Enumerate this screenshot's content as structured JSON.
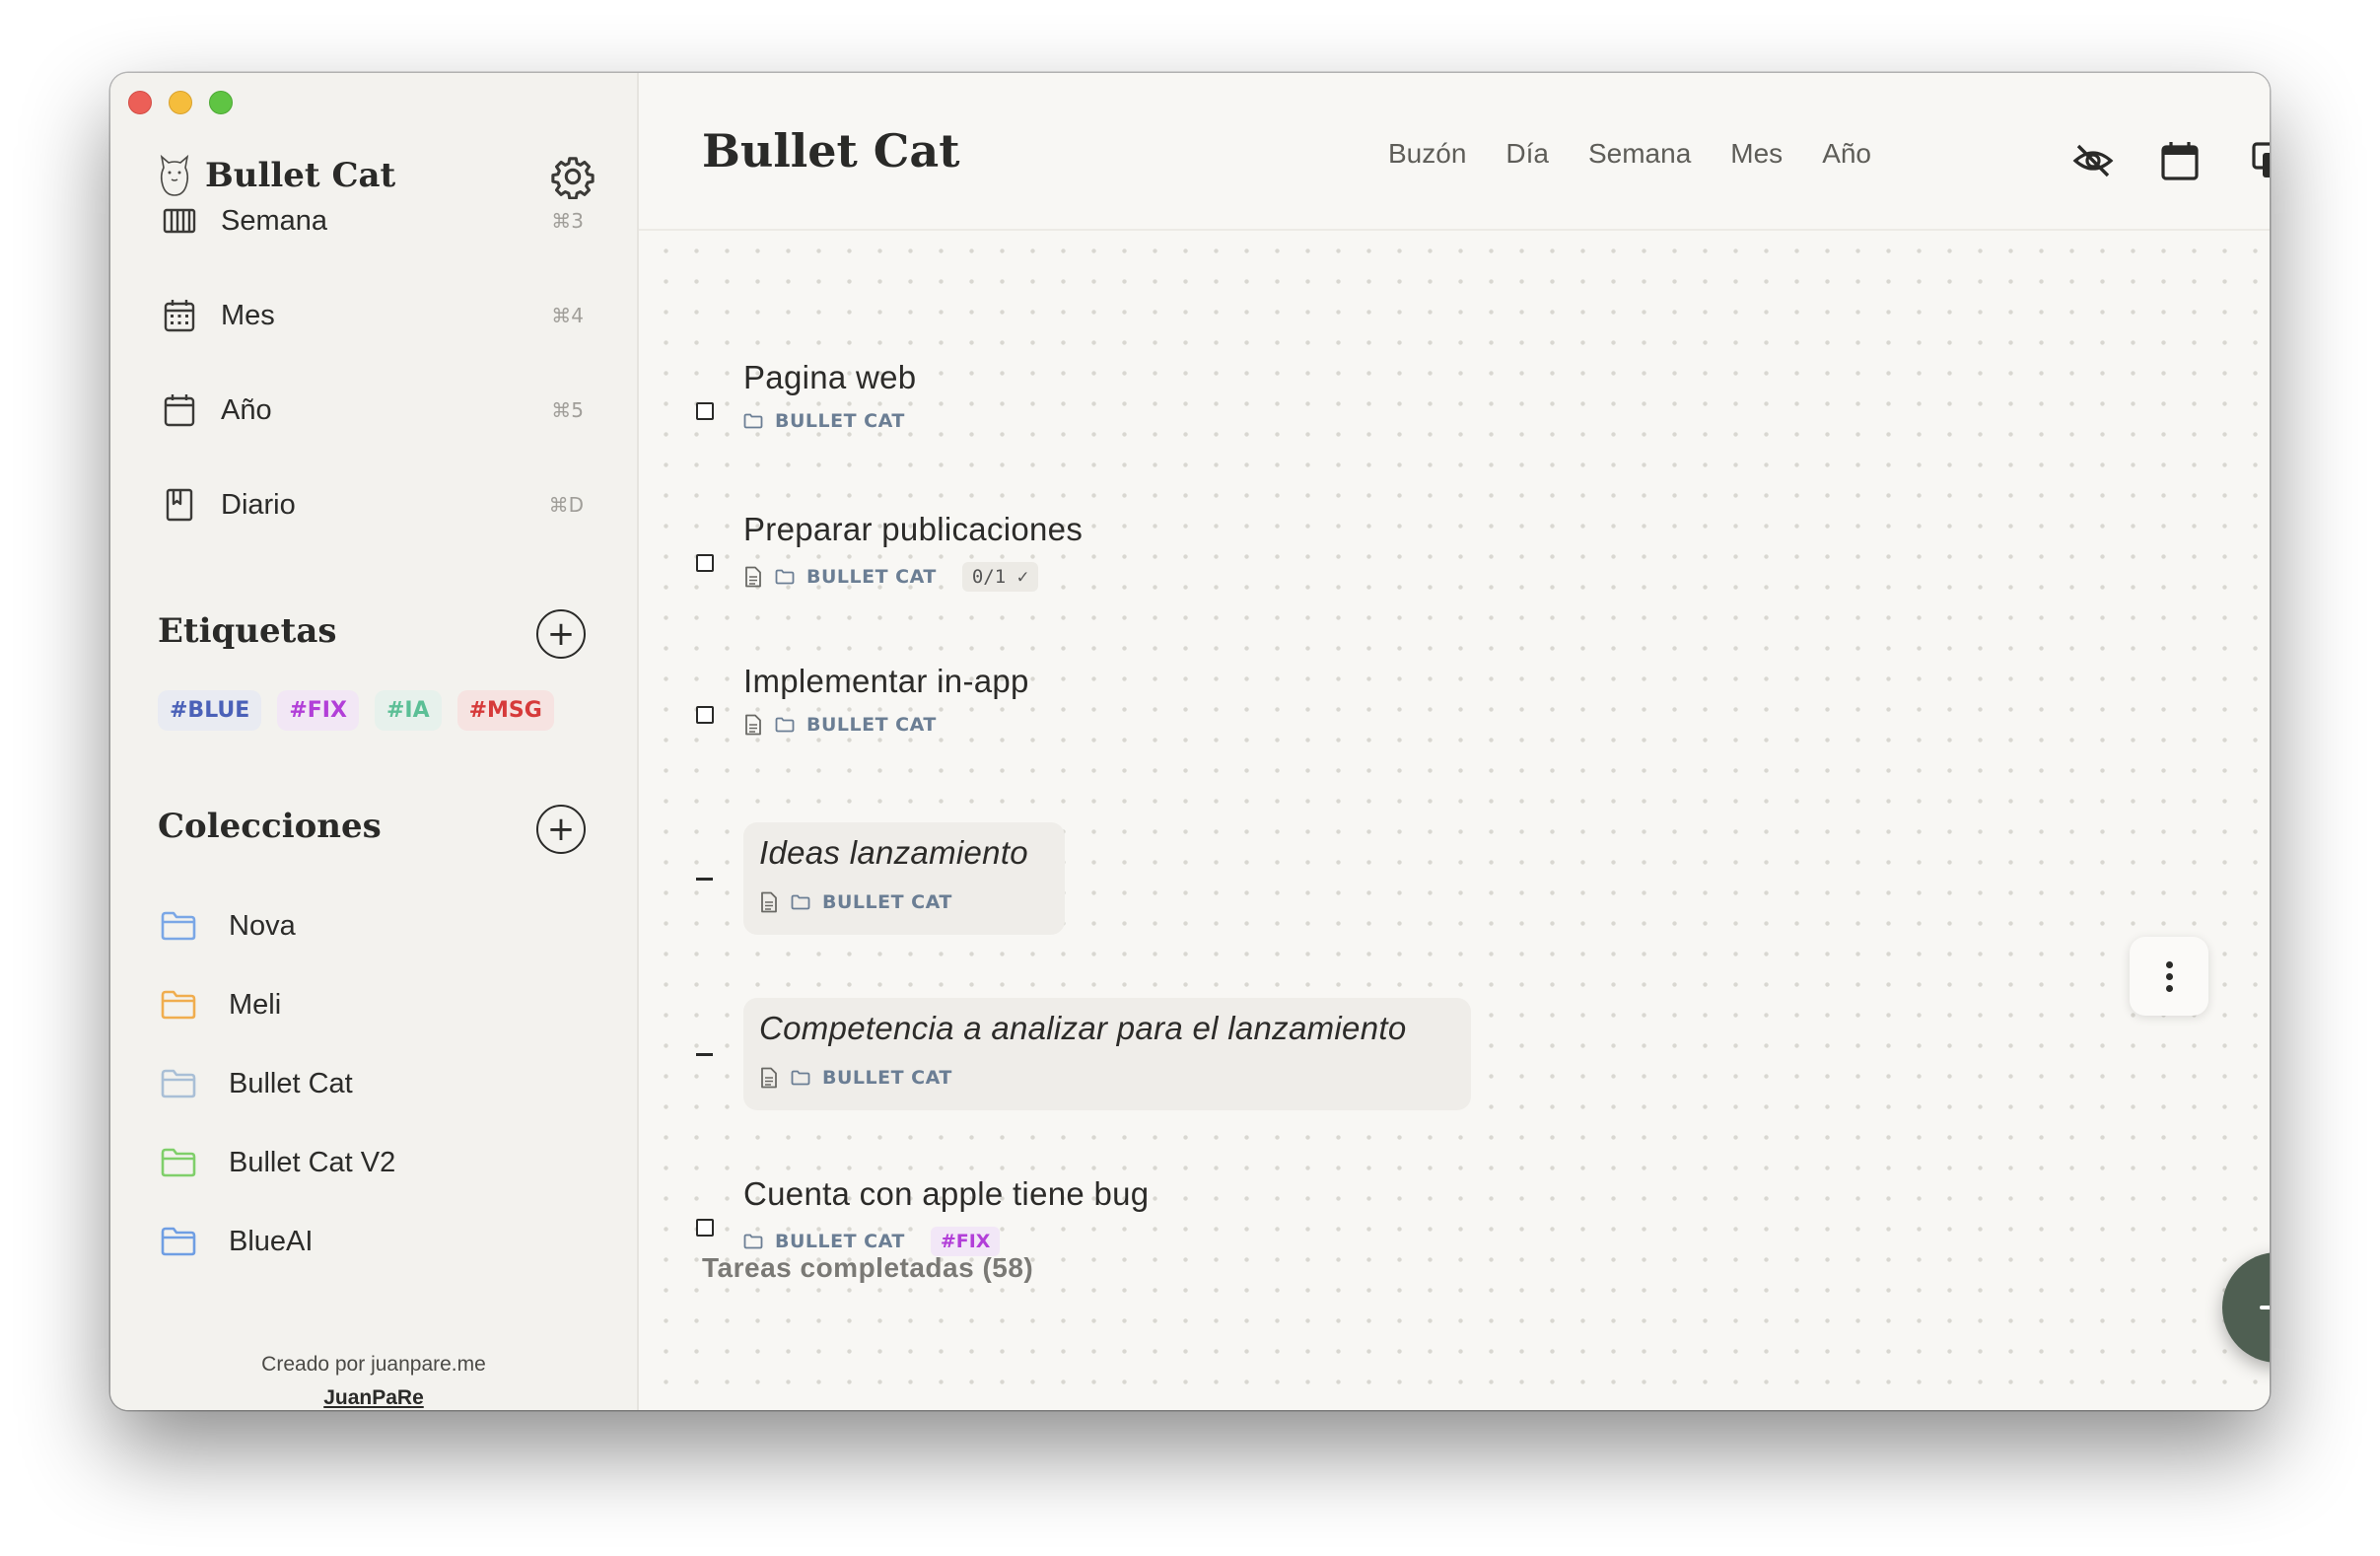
{
  "app": {
    "name": "Bullet Cat"
  },
  "sidebar": {
    "nav": [
      {
        "label": "Semana",
        "shortcut": "⌘3",
        "icon": "week-columns-icon"
      },
      {
        "label": "Mes",
        "shortcut": "⌘4",
        "icon": "calendar-grid-icon"
      },
      {
        "label": "Año",
        "shortcut": "⌘5",
        "icon": "calendar-icon"
      },
      {
        "label": "Diario",
        "shortcut": "⌘D",
        "icon": "journal-icon"
      }
    ],
    "tags_title": "Etiquetas",
    "tags": [
      {
        "label": "#BLUE",
        "color": "#4b61b8",
        "bg": "#e9ebf2"
      },
      {
        "label": "#FIX",
        "color": "#b23fd8",
        "bg": "#f2e7f5"
      },
      {
        "label": "#IA",
        "color": "#5cbf96",
        "bg": "#e7f1ec"
      },
      {
        "label": "#MSG",
        "color": "#d63a3a",
        "bg": "#f6e3e1"
      }
    ],
    "collections_title": "Colecciones",
    "collections": [
      {
        "label": "Nova",
        "color": "#7aa7e6"
      },
      {
        "label": "Meli",
        "color": "#f0ad4e"
      },
      {
        "label": "Bullet Cat",
        "color": "#a9bfd6"
      },
      {
        "label": "Bullet Cat V2",
        "color": "#7fcf6a"
      },
      {
        "label": "BlueAI",
        "color": "#6f9ee3"
      }
    ],
    "credit": "Creado por juanpare.me",
    "credit_link": "JuanPaRe"
  },
  "header": {
    "title": "Bullet Cat",
    "tabs": [
      "Buzón",
      "Día",
      "Semana",
      "Mes",
      "Año"
    ]
  },
  "tasks": [
    {
      "title": "Pagina web",
      "collection": "BULLET CAT"
    },
    {
      "title": "Preparar publicaciones",
      "collection": "BULLET CAT",
      "subtasks": "0/1 ✓"
    },
    {
      "title": "Implementar in-app",
      "collection": "BULLET CAT"
    }
  ],
  "notes": [
    {
      "title": "Ideas lanzamiento",
      "collection": "BULLET CAT"
    },
    {
      "title": "Competencia a analizar para el lanzamiento",
      "collection": "BULLET CAT"
    }
  ],
  "last_task": {
    "title": "Cuenta con apple tiene bug",
    "collection": "BULLET CAT",
    "tag": "#FIX"
  },
  "completed_label": "Tareas completadas (58)"
}
